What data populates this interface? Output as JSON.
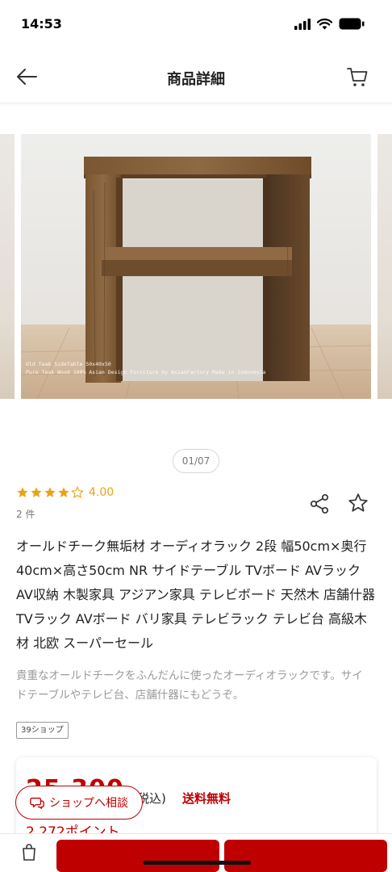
{
  "status_bar": {
    "time": "14:53"
  },
  "header": {
    "title": "商品詳細",
    "back_icon": "arrow-left-icon",
    "cart_icon": "cart-icon"
  },
  "gallery": {
    "caption_line1": "Old Teak SideTable 50x40x50",
    "caption_line2": "Pure Teak Wood 100% Asian Design Furniture by AsianFactory Made in Indonesia",
    "page_indicator": "01/07"
  },
  "rating": {
    "value": "4.00",
    "stars_filled": 4,
    "stars_total": 5,
    "count": "2 件"
  },
  "product": {
    "title": "オールドチーク無垢材 オーディオラック 2段 幅50cm×奥行40cm×高さ50cm NR サイドテーブル TVボード AVラック AV収納 木製家具 アジアン家具 テレビボード 天然木 店舗什器 TVラック AVボード バリ家具 テレビラック テレビ台 高級木材 北欧 スーパーセール",
    "description": "貴重なオールドチークをふんだんに使ったオーディオラックです。サイドテーブルやテレビ台、店舗什器にもどうぞ。",
    "shop_tag": "39ショップ"
  },
  "price": {
    "amount": "25,300",
    "tax_label": "税込)",
    "shipping": "送料無料",
    "points": "2,272ポイント"
  },
  "consult": {
    "label": "ショップへ相談"
  },
  "colors": {
    "accent": "#bf0000",
    "star": "#e8a317",
    "muted_text": "#9a9a9a"
  }
}
